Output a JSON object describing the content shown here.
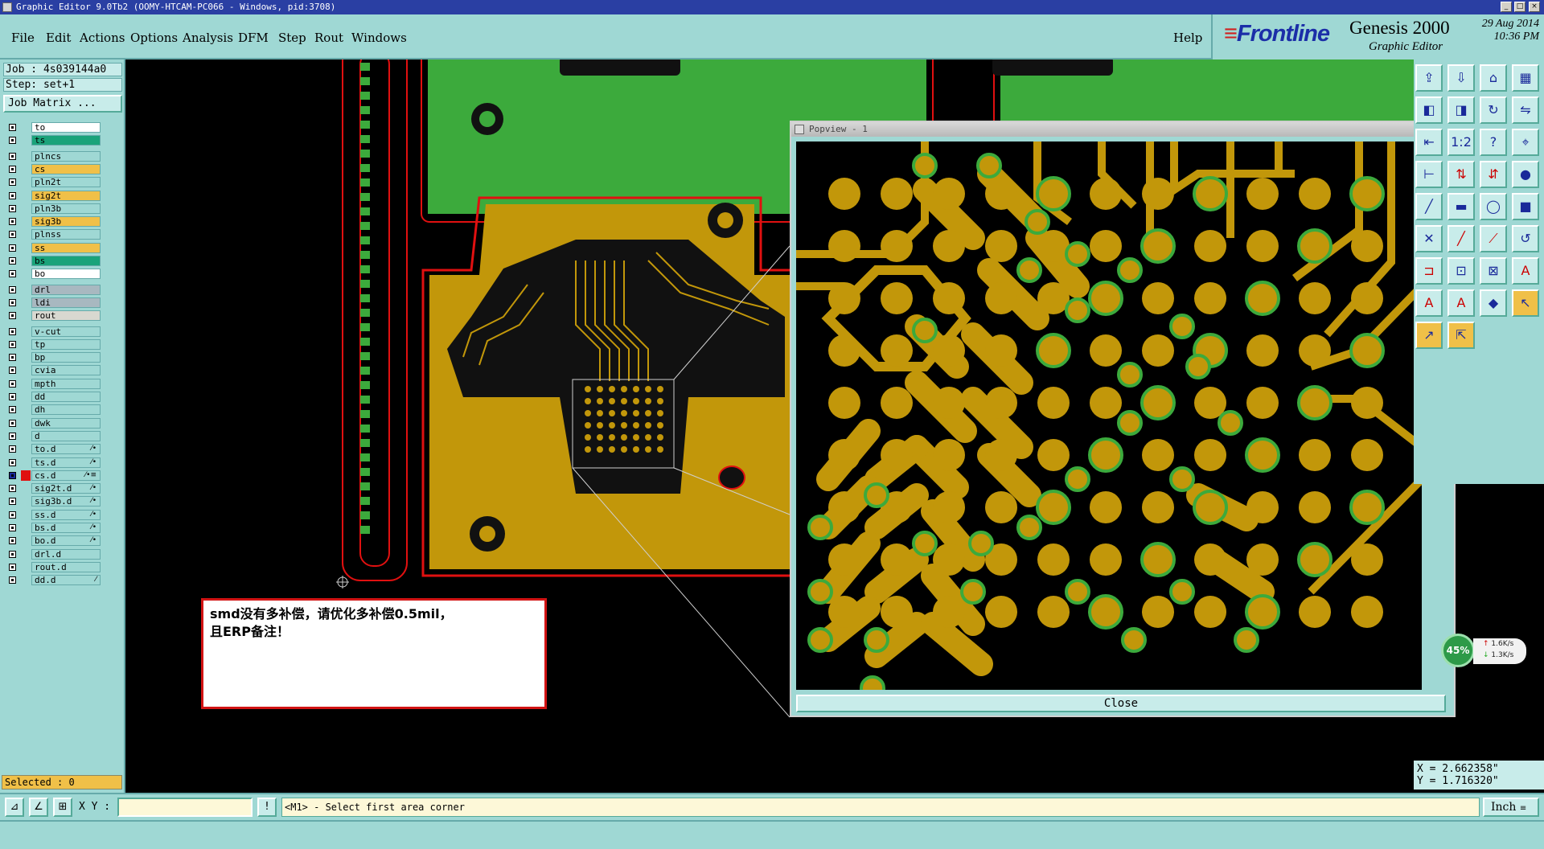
{
  "window": {
    "title": "Graphic Editor 9.0Tb2 (OOMY-HTCAM-PC066 - Windows, pid:3708)"
  },
  "menu": {
    "items": [
      "File",
      "Edit",
      "Actions",
      "Options",
      "Analysis",
      "DFM",
      "Step",
      "Rout",
      "Windows"
    ],
    "help": "Help"
  },
  "brand": {
    "logo": "Frontline",
    "product": "Genesis 2000",
    "subtitle": "Graphic Editor",
    "date": "29 Aug 2014",
    "time": "10:36 PM"
  },
  "job": {
    "job_label": "Job : 4s039144a0",
    "step_label": "Step: set+1",
    "matrix_button": "Job Matrix ..."
  },
  "layers": [
    {
      "name": "to",
      "color": "#ffffff"
    },
    {
      "name": "ts",
      "color": "#1aa37a"
    },
    {
      "name": "plncs",
      "color": "#9fd8d4"
    },
    {
      "name": "cs",
      "color": "#f0c048"
    },
    {
      "name": "pln2t",
      "color": "#9fd8d4"
    },
    {
      "name": "sig2t",
      "color": "#f0c048"
    },
    {
      "name": "pln3b",
      "color": "#9fd8d4"
    },
    {
      "name": "sig3b",
      "color": "#f0c048"
    },
    {
      "name": "plnss",
      "color": "#9fd8d4"
    },
    {
      "name": "ss",
      "color": "#f0c048"
    },
    {
      "name": "bs",
      "color": "#1aa37a"
    },
    {
      "name": "bo",
      "color": "#ffffff"
    },
    {
      "name": "drl",
      "color": "#a8b8c0"
    },
    {
      "name": "ldi",
      "color": "#a8b8c0"
    },
    {
      "name": "rout",
      "color": "#d8d8d0"
    },
    {
      "name": "v-cut",
      "color": "#9fd8d4"
    },
    {
      "name": "tp",
      "color": "#9fd8d4"
    },
    {
      "name": "bp",
      "color": "#9fd8d4"
    },
    {
      "name": "cvia",
      "color": "#9fd8d4"
    },
    {
      "name": "mpth",
      "color": "#9fd8d4"
    },
    {
      "name": "dd",
      "color": "#9fd8d4"
    },
    {
      "name": "dh",
      "color": "#9fd8d4"
    },
    {
      "name": "dwk",
      "color": "#9fd8d4"
    },
    {
      "name": "d",
      "color": "#9fd8d4"
    },
    {
      "name": "to.d",
      "color": "#9fd8d4",
      "mark": "⁄•"
    },
    {
      "name": "ts.d",
      "color": "#9fd8d4",
      "mark": "⁄•"
    },
    {
      "name": "cs.d",
      "color": "#9fd8d4",
      "mark": "⁄•≡",
      "active": true
    },
    {
      "name": "sig2t.d",
      "color": "#9fd8d4",
      "mark": "⁄•"
    },
    {
      "name": "sig3b.d",
      "color": "#9fd8d4",
      "mark": "⁄•"
    },
    {
      "name": "ss.d",
      "color": "#9fd8d4",
      "mark": "⁄•"
    },
    {
      "name": "bs.d",
      "color": "#9fd8d4",
      "mark": "⁄•"
    },
    {
      "name": "bo.d",
      "color": "#9fd8d4",
      "mark": "⁄•"
    },
    {
      "name": "drl.d",
      "color": "#9fd8d4"
    },
    {
      "name": "rout.d",
      "color": "#9fd8d4"
    },
    {
      "name": "dd.d",
      "color": "#9fd8d4",
      "mark": "⁄"
    }
  ],
  "status": {
    "selected": "Selected : 0"
  },
  "note": {
    "line1": "smd没有多补偿，请优化多补偿0.5mil，",
    "line2": "且ERP备注！"
  },
  "popview": {
    "title": "Popview - 1",
    "close_button": "Close"
  },
  "coords": {
    "x": "X = 2.662358\"",
    "y": "Y = 1.716320\""
  },
  "command": {
    "xy_label": "X Y :",
    "xy_value": "",
    "message": "<M1> - Select first area corner",
    "units": "Inch"
  },
  "netmon": {
    "percent": "45%",
    "up": "1.6K/s",
    "down": "1.3K/s"
  },
  "colors": {
    "copper": "#c2970a",
    "soldermask_green": "#3caa3c",
    "outline_red": "#e01010",
    "panel_teal": "#9fd8d4"
  }
}
